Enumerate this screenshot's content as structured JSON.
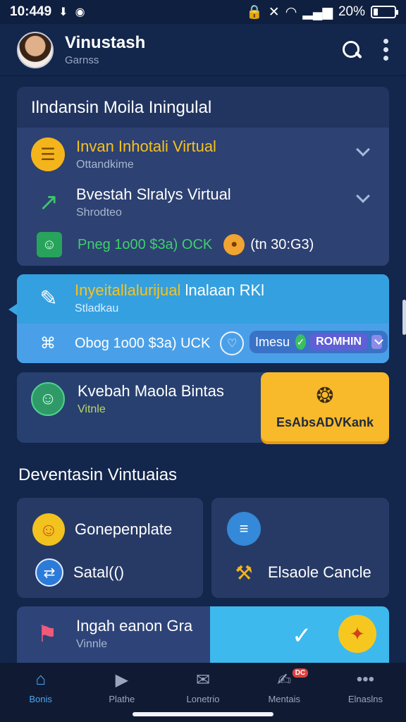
{
  "status_bar": {
    "time": "10:449",
    "battery": "20%"
  },
  "app_bar": {
    "name": "Vinustash",
    "subtitle": "Garnss"
  },
  "card1": {
    "title": "Ilndansin Moila Iningulal",
    "item1": {
      "title": "Invan Inhotali Virtual",
      "subtitle": "Ottandkime"
    },
    "item2": {
      "title": "Bvestah Slralys Virtual",
      "subtitle": "Shrodteo"
    },
    "row3": {
      "left_text": "Pneg 1o00 $3a) OCK",
      "right_text": "(tn 30:G3)"
    }
  },
  "card2": {
    "title_yellow": "Inyeitallalurijual",
    "title_rest": "lnalaan RKl",
    "subtitle": "Stladkau",
    "lower_text": "Obog 1o00 $3a) UCK",
    "lower_pill_label": "Imesu",
    "lower_chip": "ROMHIN"
  },
  "card3": {
    "title": "Kvebah Maola Bintas",
    "subtitle": "Vitnle",
    "button_label": "EsAbsADVKank"
  },
  "section": {
    "title": "Deventasin Vintuaias"
  },
  "grid": {
    "left": {
      "item1": "Gonepenplate",
      "item2": "Satal(()"
    },
    "right": {
      "item2": "Elsaole Cancle"
    }
  },
  "promo": {
    "title": "Ingah eanon Gra",
    "subtitle": "Vinnle"
  },
  "bottom_nav": [
    {
      "label": "Bonis",
      "icon": "home-icon",
      "active": true
    },
    {
      "label": "Plathe",
      "icon": "play-chat-icon",
      "active": false
    },
    {
      "label": "Lonetrio",
      "icon": "mailbox-icon",
      "active": false
    },
    {
      "label": "Mentais",
      "icon": "edit-icon",
      "active": false,
      "badge": "DC"
    },
    {
      "label": "Elnaslns",
      "icon": "more-icon",
      "active": false
    }
  ],
  "colors": {
    "background": "#13264b",
    "accent_blue": "#3aa5e3",
    "accent_yellow": "#f8b92b",
    "green": "#3fd06d"
  }
}
